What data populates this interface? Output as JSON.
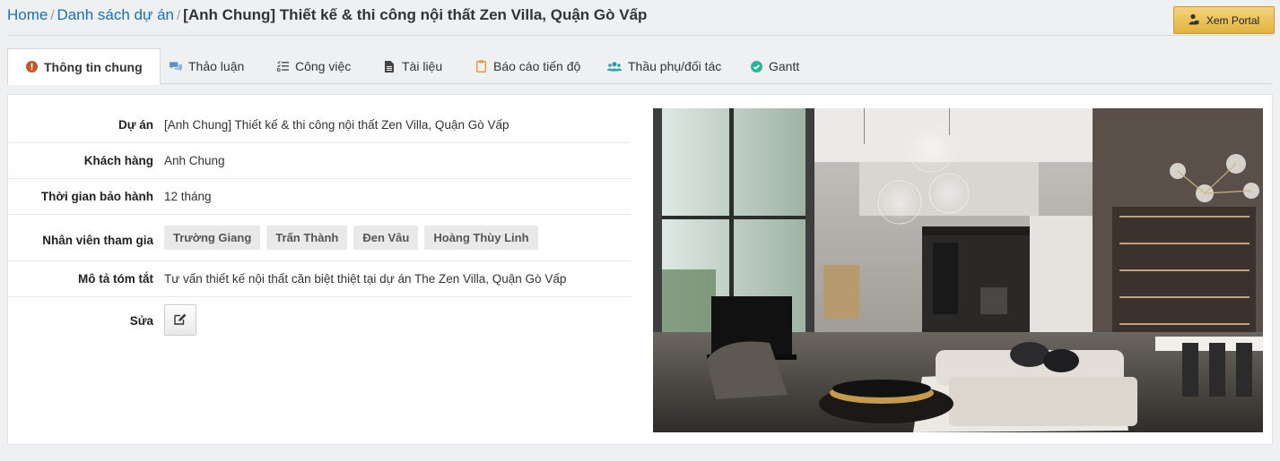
{
  "breadcrumb": {
    "home": "Home",
    "separator": "/",
    "list": "Danh sách dự án",
    "current": "[Anh Chung] Thiết kế & thi công nội thất Zen Villa, Quận Gò Vấp"
  },
  "portal_button": {
    "label": "Xem Portal",
    "icon": "user-lock-icon"
  },
  "tabs": [
    {
      "label": "Thông tin chung",
      "icon": "info-circle-icon",
      "active": true
    },
    {
      "label": "Thảo luận",
      "icon": "comments-icon"
    },
    {
      "label": "Công việc",
      "icon": "tasks-icon"
    },
    {
      "label": "Tài liệu",
      "icon": "document-icon"
    },
    {
      "label": "Báo cáo tiến độ",
      "icon": "clipboard-icon"
    },
    {
      "label": "Thầu phụ/đối tác",
      "icon": "users-icon"
    },
    {
      "label": "Gantt",
      "icon": "check-circle-icon"
    }
  ],
  "details": {
    "project_label": "Dự án",
    "project_value": "[Anh Chung] Thiết kế & thi công nội thất Zen Villa, Quận Gò Vấp",
    "customer_label": "Khách hàng",
    "customer_value": "Anh Chung",
    "warranty_label": "Thời gian bảo hành",
    "warranty_value": "12 tháng",
    "staff_label": "Nhân viên tham gia",
    "staff": [
      "Trường Giang",
      "Trấn Thành",
      "Đen Vâu",
      "Hoàng Thùy Linh"
    ],
    "description_label": "Mô tả tóm tắt",
    "description_value": "Tư vấn thiết kế nội thất căn biệt thiệt tại dự án The Zen Villa, Quận Gò Vấp",
    "edit_label": "Sửa"
  },
  "colors": {
    "link": "#1a6fb7",
    "portal_button": "#e8bd4f",
    "info_icon": "#c0562b",
    "blue_icon": "#5b8fc9",
    "orange_icon": "#e8943a",
    "teal_icon": "#2aa0a6",
    "green_icon": "#2bb49b"
  }
}
